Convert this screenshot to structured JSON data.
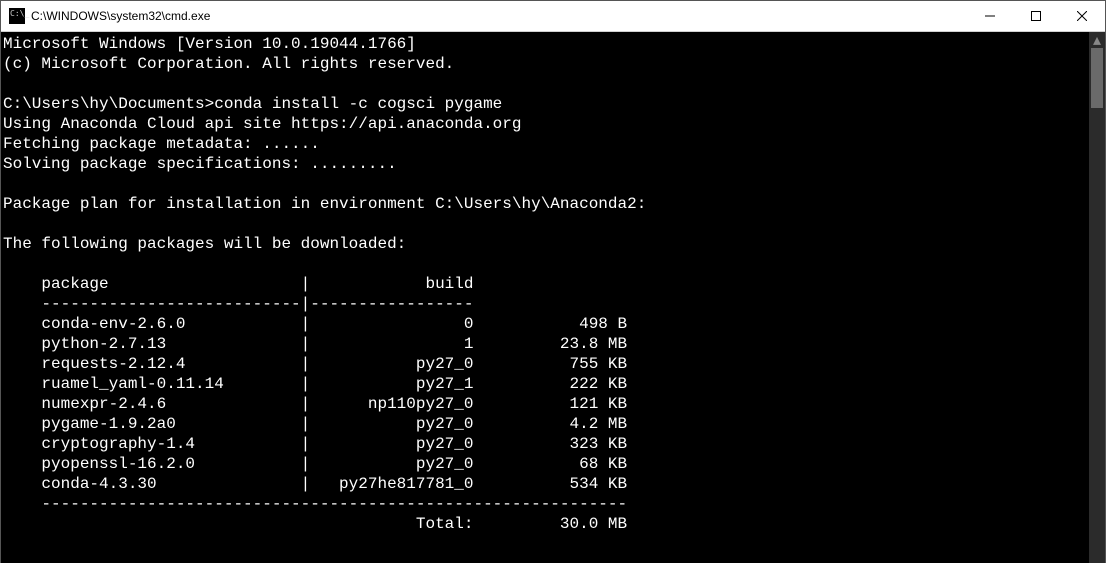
{
  "window": {
    "title": "C:\\WINDOWS\\system32\\cmd.exe"
  },
  "header": {
    "line1": "Microsoft Windows [Version 10.0.19044.1766]",
    "line2": "(c) Microsoft Corporation. All rights reserved."
  },
  "prompt": {
    "cwd": "C:\\Users\\hy\\Documents>",
    "command": "conda install -c cogsci pygame"
  },
  "progress": {
    "line1": "Using Anaconda Cloud api site https://api.anaconda.org",
    "line2": "Fetching package metadata: ......",
    "line3": "Solving package specifications: .........",
    "plan": "Package plan for installation in environment C:\\Users\\hy\\Anaconda2:",
    "dlhdr": "The following packages will be downloaded:"
  },
  "table": {
    "col1": "package",
    "col2": "build",
    "rows": [
      {
        "pkg": "conda-env-2.6.0",
        "build": "0",
        "size": "498 B"
      },
      {
        "pkg": "python-2.7.13",
        "build": "1",
        "size": "23.8 MB"
      },
      {
        "pkg": "requests-2.12.4",
        "build": "py27_0",
        "size": "755 KB"
      },
      {
        "pkg": "ruamel_yaml-0.11.14",
        "build": "py27_1",
        "size": "222 KB"
      },
      {
        "pkg": "numexpr-2.4.6",
        "build": "np110py27_0",
        "size": "121 KB"
      },
      {
        "pkg": "pygame-1.9.2a0",
        "build": "py27_0",
        "size": "4.2 MB"
      },
      {
        "pkg": "cryptography-1.4",
        "build": "py27_0",
        "size": "323 KB"
      },
      {
        "pkg": "pyopenssl-16.2.0",
        "build": "py27_0",
        "size": "68 KB"
      },
      {
        "pkg": "conda-4.3.30",
        "build": "py27he817781_0",
        "size": "534 KB"
      }
    ],
    "total_label": "Total:",
    "total_size": "30.0 MB"
  }
}
